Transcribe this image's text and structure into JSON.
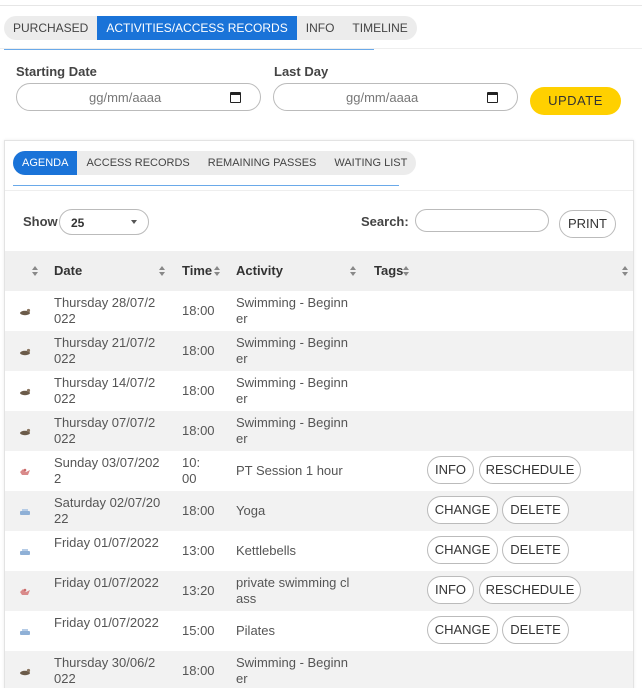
{
  "top_tabs": [
    {
      "label": "PURCHASED"
    },
    {
      "label": "ACTIVITIES/ACCESS RECORDS"
    },
    {
      "label": "INFO"
    },
    {
      "label": "TIMELINE"
    }
  ],
  "filters": {
    "start_label": "Starting Date",
    "start_placeholder": "gg/mm/aaaa",
    "end_label": "Last Day",
    "end_placeholder": "gg/mm/aaaa",
    "update_label": "UPDATE"
  },
  "sub_tabs": [
    {
      "label": "AGENDA"
    },
    {
      "label": "ACCESS RECORDS"
    },
    {
      "label": "REMAINING PASSES"
    },
    {
      "label": "WAITING LIST"
    }
  ],
  "table_controls": {
    "show_label": "Show",
    "show_value": "25",
    "search_label": "Search:",
    "print_label": "PRINT"
  },
  "columns": [
    "Date",
    "Time",
    "Activity",
    "Tags"
  ],
  "rows": [
    {
      "date": "Thursday 28/07/2022",
      "time": "18:00",
      "activity": "Swimming - Beginner",
      "icon": "swim-icon"
    },
    {
      "date": "Thursday 21/07/2022",
      "time": "18:00",
      "activity": "Swimming - Beginner",
      "icon": "swim-icon"
    },
    {
      "date": "Thursday 14/07/2022",
      "time": "18:00",
      "activity": "Swimming - Beginner",
      "icon": "swim-icon"
    },
    {
      "date": "Thursday 07/07/2022",
      "time": "18:00",
      "activity": "Swimming - Beginner",
      "icon": "swim-icon"
    },
    {
      "date": "Sunday 03/07/2022",
      "time": "10:00",
      "activity": "PT Session 1 hour",
      "icon": "pt-icon",
      "buttons": [
        "INFO",
        "RESCHEDULE"
      ]
    },
    {
      "date": "Saturday 02/07/2022",
      "time": "18:00",
      "activity": "Yoga",
      "icon": "class-icon",
      "buttons": [
        "CHANGE",
        "DELETE"
      ]
    },
    {
      "date": "Friday 01/07/2022",
      "time": "13:00",
      "activity": "Kettlebells",
      "icon": "class-icon",
      "buttons": [
        "CHANGE",
        "DELETE"
      ]
    },
    {
      "date": "Friday 01/07/2022",
      "time": "13:20",
      "activity": "private swimming class",
      "icon": "pt-icon",
      "buttons": [
        "INFO",
        "RESCHEDULE"
      ]
    },
    {
      "date": "Friday 01/07/2022",
      "time": "15:00",
      "activity": "Pilates",
      "icon": "class-icon",
      "buttons": [
        "CHANGE",
        "DELETE"
      ]
    },
    {
      "date": "Thursday 30/06/2022",
      "time": "18:00",
      "activity": "Swimming - Beginner",
      "icon": "swim-icon"
    }
  ],
  "colors": {
    "accent": "#1a73d8",
    "update_button": "#ffd000"
  }
}
